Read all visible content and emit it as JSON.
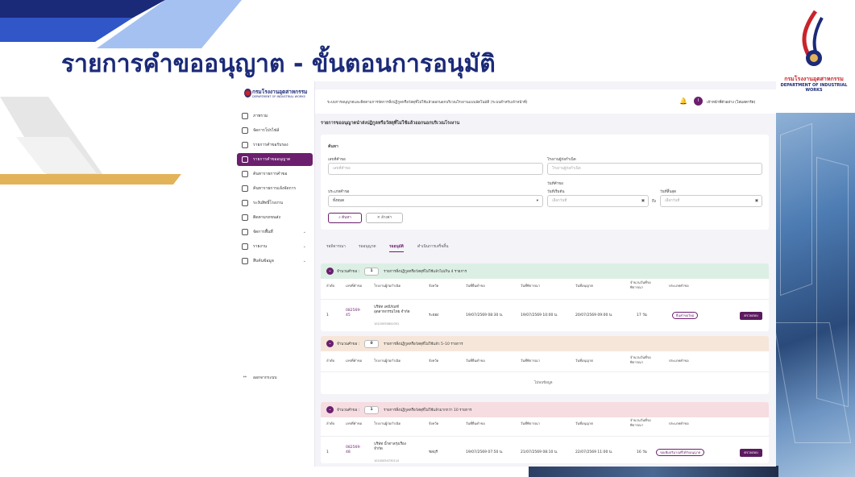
{
  "slide_title": "รายการคำขออนุญาต - ขั้นตอนการอนุมัติ",
  "logo": {
    "line1": "กรมโรงงานอุตสาหกรรม",
    "line2": "DEPARTMENT OF INDUSTRIAL WORKS"
  },
  "app": {
    "brand": {
      "name": "กรมโรงงานอุตสาหกรรม",
      "sub": "DEPARTMENT OF INDUSTRIAL WORKS"
    },
    "sidebar": {
      "items": [
        {
          "label": "ภาพรวม",
          "icon": "grid-icon"
        },
        {
          "label": "จัดการโปรไฟล์",
          "icon": "profile-icon"
        },
        {
          "label": "รายการคำขอรับรอง",
          "icon": "checklist-icon"
        },
        {
          "label": "รายการคำขออนุญาต",
          "icon": "document-icon"
        },
        {
          "label": "ค้นหารายการคำขอ",
          "icon": "search-document-icon"
        },
        {
          "label": "ค้นหารายการแจ้งจัดการ",
          "icon": "search-list-icon"
        },
        {
          "label": "ระงับสิทธิ์โรงงาน",
          "icon": "shield-icon"
        },
        {
          "label": "ติดตามรถขนส่ง",
          "icon": "map-icon"
        },
        {
          "label": "จัดการพื้นที่",
          "icon": "layers-icon"
        },
        {
          "label": "รายงาน",
          "icon": "report-icon"
        },
        {
          "label": "สืบค้นข้อมูล",
          "icon": "data-search-icon"
        }
      ],
      "logout": "ออกจากระบบ"
    },
    "topbar": {
      "system_name": "ระบบการอนุญาตและติดตามการจัดการสิ่งปฏิกูลหรือวัสดุที่ไม่ใช้แล้วออกนอกบริเวณโรงงานแบบอัตโนมัติ (ระบบสำหรับเจ้าหน้าที่)",
      "avatar_initial": "I",
      "user_name": "เจ้าหน้าที่ตัวอย่าง (โสมสตาร์ต)"
    },
    "page_title": "รายการขออนุญาตนำส่งปฏิกูลหรือวัสดุที่ไม่ใช้แล้วออกนอกบริเวณโรงงาน",
    "search": {
      "heading": "ค้นหา",
      "request_no_label": "เลขที่คำขอ",
      "request_no_placeholder": "เลขที่คำขอ",
      "factory_label": "โรงงานผู้ก่อกำเนิด",
      "factory_placeholder": "โรงงานผู้ก่อกำเนิด",
      "type_label": "ประเภทคำขอ",
      "type_value": "ทั้งหมด",
      "date_group_label": "วันที่คำขอ",
      "start_label": "วันที่เริ่มต้น",
      "start_placeholder": "เลือกวันที่",
      "to": "ถึง",
      "end_label": "วันที่สิ้นสุด",
      "end_placeholder": "เลือกวันที่",
      "search_button": "ค้นหา",
      "clear_button": "ล้างค่า"
    },
    "tabs": [
      "รอพิจารณา",
      "รออนุญาต",
      "รออนุมัติ",
      "ดำเนินการเสร็จสิ้น"
    ],
    "sections": [
      {
        "label": "จำนวนคำขอ :",
        "count": "1",
        "desc": "รายการสิ่งปฏิกูลหรือวัสดุที่ไม่ใช้แล้วไม่เกิน 4 รายการ",
        "color": "#dcefe4",
        "columns": [
          "ลำดับ",
          "เลขที่คำขอ",
          "โรงงานผู้ก่อกำเนิด",
          "จังหวัด",
          "วันที่ยื่นคำขอ",
          "วันที่พิจารณา",
          "วันที่อนุญาต",
          "จำนวนวันที่รอพิจารณา",
          "ประเภทคำขอ"
        ],
        "rows": [
          {
            "no": "1",
            "req": "082569-45",
            "factory": "บริษัท เคมีภัณฑ์อุตสาหกรรมไทย จำกัด",
            "factory_id": "10120050841001",
            "province": "ระยอง",
            "submit": "19/07/2569 08:30 น.",
            "review": "19/07/2569 10:00 น.",
            "approve": "20/07/2569 09:00 น.",
            "days": "17 วัน",
            "type": "ยื่นคำขอใหม่",
            "action": "ตรวจสอบ"
          }
        ]
      },
      {
        "label": "จำนวนคำขอ :",
        "count": "0",
        "desc": "รายการสิ่งปฏิกูลหรือวัสดุที่ไม่ใช้แล้ว 5–10 รายการ",
        "color": "#f6e6da",
        "columns": [
          "ลำดับ",
          "เลขที่คำขอ",
          "โรงงานผู้ก่อกำเนิด",
          "จังหวัด",
          "วันที่ยื่นคำขอ",
          "วันที่พิจารณา",
          "วันที่อนุญาต",
          "จำนวนวันที่รอพิจารณา",
          "ประเภทคำขอ"
        ],
        "empty": "ไม่พบข้อมูล"
      },
      {
        "label": "จำนวนคำขอ :",
        "count": "1",
        "desc": "รายการสิ่งปฏิกูลหรือวัสดุที่ไม่ใช้แล้วมากกว่า 10 รายการ",
        "color": "#f6dde1",
        "columns": [
          "ลำดับ",
          "เลขที่คำขอ",
          "โรงงานผู้ก่อกำเนิด",
          "จังหวัด",
          "วันที่ยื่นคำขอ",
          "วันที่พิจารณา",
          "วันที่อนุญาต",
          "จำนวนวันที่รอพิจารณา",
          "ประเภทคำขอ"
        ],
        "rows": [
          {
            "no": "1",
            "req": "082569-48",
            "factory": "บริษัท น้ำตาลรุ่งเรือง จำกัด",
            "factory_id": "10100054730110",
            "province": "ชลบุรี",
            "submit": "19/07/2569 07:50 น.",
            "review": "21/07/2569 08:10 น.",
            "approve": "22/07/2569 11:00 น.",
            "days": "16 วัน",
            "type": "ขอเพิ่มปริมาณที่ได้รับอนุญาต",
            "action": "ตรวจสอบ"
          }
        ]
      }
    ]
  }
}
